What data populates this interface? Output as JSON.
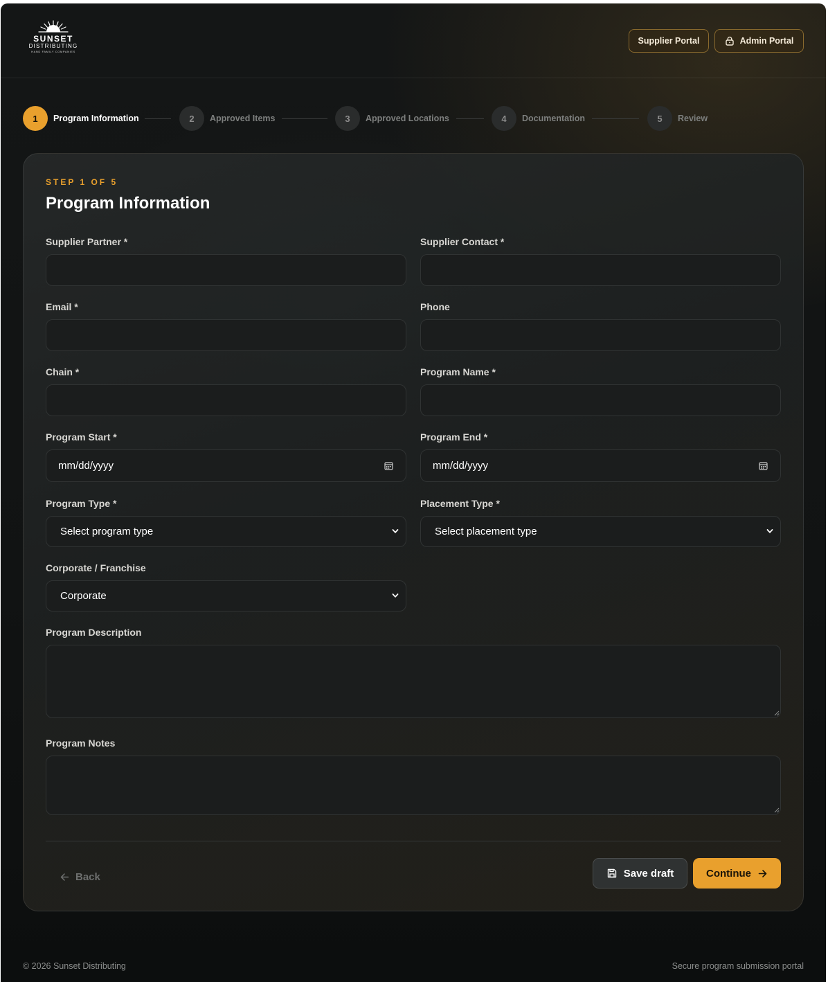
{
  "brand": {
    "name": "SUNSET",
    "sub": "DISTRIBUTING",
    "tagline": "HAND FAMILY COMPANIES"
  },
  "header": {
    "supplier_portal_label": "Supplier Portal",
    "admin_portal_label": "Admin Portal",
    "admin_icon": "lock-icon"
  },
  "stepper": {
    "steps": [
      {
        "number": "1",
        "label": "Program Information",
        "active": true
      },
      {
        "number": "2",
        "label": "Approved Items",
        "active": false
      },
      {
        "number": "3",
        "label": "Approved Locations",
        "active": false
      },
      {
        "number": "4",
        "label": "Documentation",
        "active": false
      },
      {
        "number": "5",
        "label": "Review",
        "active": false
      }
    ]
  },
  "form": {
    "eyebrow": "STEP 1 OF 5",
    "title": "Program Information",
    "supplier_partner": {
      "label": "Supplier Partner *",
      "value": ""
    },
    "supplier_contact": {
      "label": "Supplier Contact *",
      "value": ""
    },
    "email": {
      "label": "Email *",
      "value": ""
    },
    "phone": {
      "label": "Phone",
      "value": ""
    },
    "chain": {
      "label": "Chain *",
      "value": ""
    },
    "program_name": {
      "label": "Program Name *",
      "value": ""
    },
    "program_start": {
      "label": "Program Start *",
      "value": "mm/dd/yyyy"
    },
    "program_end": {
      "label": "Program End *",
      "value": "mm/dd/yyyy"
    },
    "program_type": {
      "label": "Program Type *",
      "value": "Select program type"
    },
    "placement_type": {
      "label": "Placement Type *",
      "value": "Select placement type"
    },
    "corporate_franchise": {
      "label": "Corporate / Franchise",
      "value": "Corporate"
    },
    "program_description": {
      "label": "Program Description",
      "value": ""
    },
    "program_notes": {
      "label": "Program Notes",
      "value": ""
    }
  },
  "actions": {
    "back_label": "Back",
    "save_draft_label": "Save draft",
    "continue_label": "Continue"
  },
  "footer": {
    "copyright": "© 2026 Sunset Distributing",
    "tagline": "Secure program submission portal"
  },
  "colors": {
    "accent": "#e9a02d",
    "background": "#131515",
    "card": "#232626"
  }
}
